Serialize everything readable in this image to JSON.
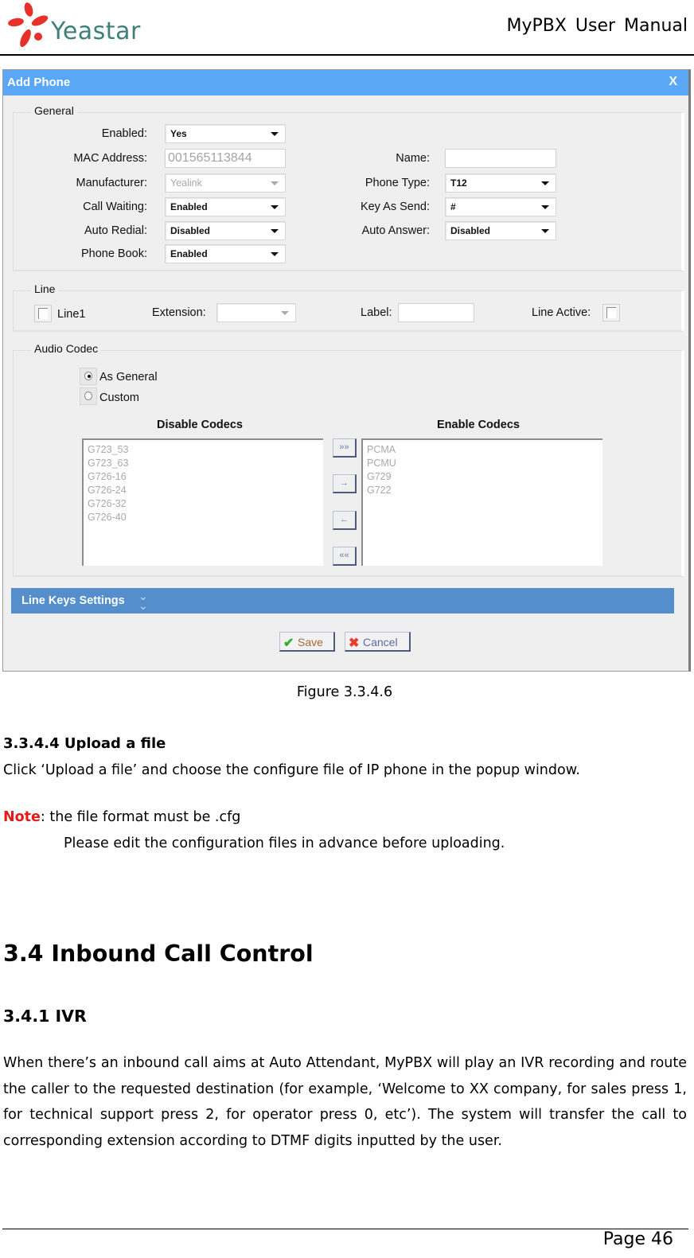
{
  "header": {
    "logo_text": "Yeastar",
    "manual_title": "MyPBX User Manual"
  },
  "dialog": {
    "title": "Add Phone",
    "close_label": "X",
    "general": {
      "legend": "General",
      "enabled": {
        "label": "Enabled:",
        "value": "Yes"
      },
      "mac_address": {
        "label": "MAC Address:",
        "value": "001565113844"
      },
      "manufacturer": {
        "label": "Manufacturer:",
        "value": "Yealink"
      },
      "call_waiting": {
        "label": "Call Waiting:",
        "value": "Enabled"
      },
      "auto_redial": {
        "label": "Auto Redial:",
        "value": "Disabled"
      },
      "phone_book": {
        "label": "Phone Book:",
        "value": "Enabled"
      },
      "name": {
        "label": "Name:",
        "value": ""
      },
      "phone_type": {
        "label": "Phone Type:",
        "value": "T12"
      },
      "key_as_send": {
        "label": "Key As Send:",
        "value": "#"
      },
      "auto_answer": {
        "label": "Auto Answer:",
        "value": "Disabled"
      }
    },
    "line": {
      "legend": "Line",
      "line1_label": "Line1",
      "line1_checked": false,
      "extension_label": "Extension:",
      "extension_value": "",
      "label_label": "Label:",
      "label_value": "",
      "line_active_label": "Line Active:",
      "line_active_checked": false
    },
    "audio_codec": {
      "legend": "Audio Codec",
      "options": [
        {
          "label": "As General",
          "checked": true
        },
        {
          "label": "Custom",
          "checked": false
        }
      ],
      "disable_heading": "Disable Codecs",
      "enable_heading": "Enable Codecs",
      "disabled_codecs": [
        "G723_53",
        "G723_63",
        "G726-16",
        "G726-24",
        "G726-32",
        "G726-40"
      ],
      "enabled_codecs": [
        "PCMA",
        "PCMU",
        "G729",
        "G722"
      ],
      "move_buttons": [
        {
          "name": "move-all-right-button",
          "glyph": "»»"
        },
        {
          "name": "move-right-button",
          "glyph": "→"
        },
        {
          "name": "move-left-button",
          "glyph": "←"
        },
        {
          "name": "move-all-left-button",
          "glyph": "««"
        }
      ]
    },
    "line_keys_settings": {
      "label": "Line Keys Settings",
      "icon": "double-chevron-down-icon"
    },
    "save_label": "Save",
    "cancel_label": "Cancel"
  },
  "document": {
    "figure_caption": "Figure 3.3.4.6",
    "section_3344_title": "3.3.4.4 Upload a file",
    "section_3344_body": "Click ‘Upload a file’ and choose the configure file of IP phone in the popup window.",
    "note_label": "Note",
    "note_text": ": the file format must be .cfg",
    "note_text2": "Please edit the configuration files in advance before uploading.",
    "section_34_title": "3.4 Inbound Call Control",
    "section_341_title": "3.4.1 IVR",
    "section_341_body": "When there’s an inbound call aims at Auto Attendant, MyPBX will play an IVR recording and route the caller to the requested destination (for example, ‘Welcome to XX company, for sales press 1, for technical support press 2, for operator press 0, etc’). The system will transfer the call to corresponding extension according to DTMF digits inputted by the user."
  },
  "footer": {
    "page_label": "Page 46"
  },
  "colors": {
    "titlebar": "#5aa7f5",
    "line_keys_bar": "#548ecc",
    "note_red": "#e41b1b",
    "logo_red": "#e8302a",
    "logo_teal": "#3d8077"
  }
}
